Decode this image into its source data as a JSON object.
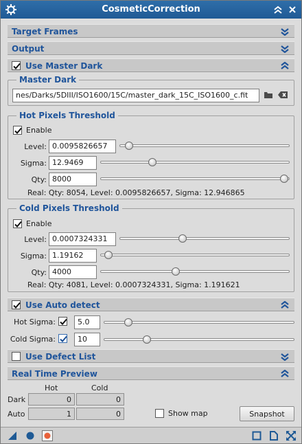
{
  "window": {
    "title": "CosmeticCorrection"
  },
  "sections": {
    "target_frames": "Target Frames",
    "output": "Output",
    "use_master_dark": "Use Master Dark",
    "use_auto_detect": "Use Auto detect",
    "use_defect_list": "Use Defect List",
    "real_time_preview": "Real Time Preview"
  },
  "master_dark": {
    "group_title": "Master Dark",
    "path": "nes/Darks/5DIII/ISO1600/15C/master_dark_15C_ISO1600_c.fit"
  },
  "hot_pixels": {
    "group_title": "Hot Pixels Threshold",
    "enable_label": "Enable",
    "level_label": "Level:",
    "level_value": "0.0095826657",
    "level_fraction": 0.03,
    "sigma_label": "Sigma:",
    "sigma_value": "12.9469",
    "sigma_fraction": 0.26,
    "qty_label": "Qty:",
    "qty_value": "8000",
    "qty_fraction": 0.99,
    "real_text": "Real: Qty: 8054, Level: 0.0095826657, Sigma: 12.946865"
  },
  "cold_pixels": {
    "group_title": "Cold Pixels Threshold",
    "enable_label": "Enable",
    "level_label": "Level:",
    "level_value": "0.0007324331",
    "level_fraction": 0.36,
    "sigma_label": "Sigma:",
    "sigma_value": "1.19162",
    "sigma_fraction": 0.02,
    "qty_label": "Qty:",
    "qty_value": "4000",
    "qty_fraction": 0.39,
    "real_text": "Real: Qty: 4081, Level: 0.0007324331, Sigma: 1.191621"
  },
  "auto_detect": {
    "hot_sigma_label": "Hot Sigma:",
    "hot_sigma_value": "5.0",
    "hot_sigma_fraction": 0.11,
    "cold_sigma_label": "Cold Sigma:",
    "cold_sigma_value": "10",
    "cold_sigma_fraction": 0.21
  },
  "preview": {
    "col_hot": "Hot",
    "col_cold": "Cold",
    "row_dark": "Dark",
    "row_auto": "Auto",
    "dark_hot": "0",
    "dark_cold": "0",
    "auto_hot": "1",
    "auto_cold": "0",
    "show_map_label": "Show map",
    "snapshot_label": "Snapshot"
  },
  "colors": {
    "accent": "#20559b",
    "title_bar": "#1f5a95"
  }
}
